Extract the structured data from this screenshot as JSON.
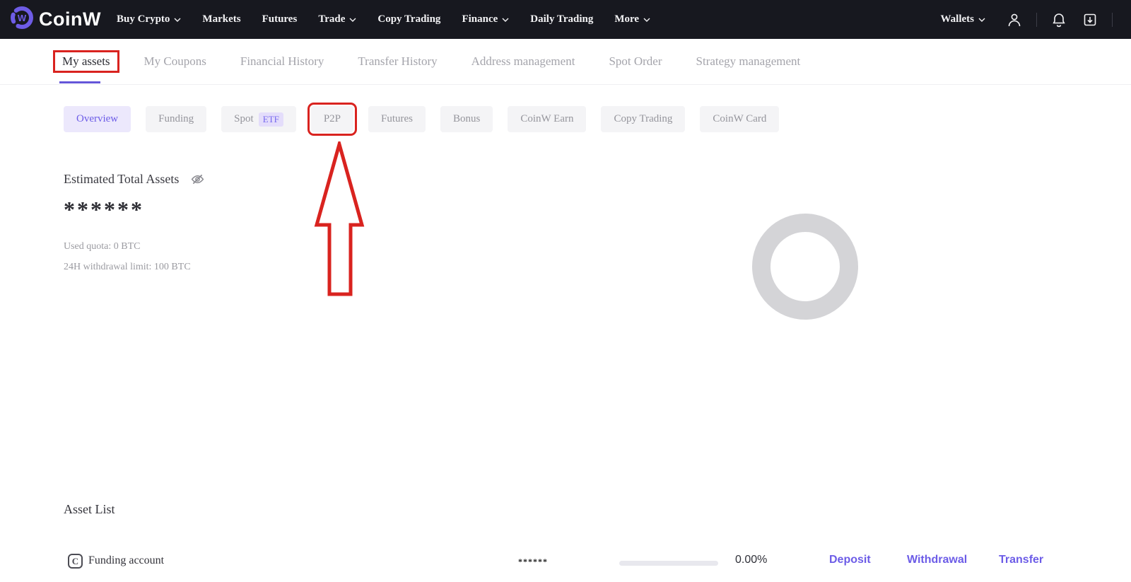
{
  "topnav": {
    "brand": "CoinW",
    "items": [
      {
        "label": "Buy Crypto",
        "dropdown": true
      },
      {
        "label": "Markets",
        "dropdown": false
      },
      {
        "label": "Futures",
        "dropdown": false
      },
      {
        "label": "Trade",
        "dropdown": true
      },
      {
        "label": "Copy Trading",
        "dropdown": false
      },
      {
        "label": "Finance",
        "dropdown": true
      },
      {
        "label": "Daily Trading",
        "dropdown": false
      },
      {
        "label": "More",
        "dropdown": true
      }
    ],
    "wallets_label": "Wallets",
    "right_icons": [
      "user-icon",
      "bell-icon",
      "download-icon"
    ]
  },
  "subnav": {
    "tabs": [
      {
        "label": "My assets",
        "active": true,
        "annotated": true
      },
      {
        "label": "My Coupons"
      },
      {
        "label": "Financial History"
      },
      {
        "label": "Transfer History"
      },
      {
        "label": "Address management"
      },
      {
        "label": "Spot Order"
      },
      {
        "label": "Strategy management"
      }
    ]
  },
  "account_pills": [
    {
      "label": "Overview",
      "active": true
    },
    {
      "label": "Funding"
    },
    {
      "label": "Spot",
      "badge": "ETF"
    },
    {
      "label": "P2P",
      "annotated": true
    },
    {
      "label": "Futures"
    },
    {
      "label": "Bonus"
    },
    {
      "label": "CoinW Earn"
    },
    {
      "label": "Copy Trading"
    },
    {
      "label": "CoinW Card"
    }
  ],
  "summary": {
    "title": "Estimated Total Assets",
    "visibility_icon": "eye-off-icon",
    "hidden_value": "******",
    "used_quota": "Used quota: 0 BTC",
    "withdrawal_limit": "24H withdrawal limit: 100 BTC"
  },
  "asset_list": {
    "title": "Asset List",
    "rows": [
      {
        "account": "Funding account",
        "hidden_value": "******",
        "percent": "0.00%",
        "actions": {
          "deposit": "Deposit",
          "withdrawal": "Withdrawal",
          "transfer": "Transfer"
        }
      }
    ]
  },
  "annotations": {
    "highlighted_tab": "My assets",
    "highlighted_pill": "P2P",
    "arrow": "up-arrow pointing to P2P pill"
  },
  "colors": {
    "accent_purple": "#6c5ce7",
    "annotation_red": "#d9231f",
    "nav_bg": "#17181f",
    "donut_gray": "#d4d4d7"
  }
}
